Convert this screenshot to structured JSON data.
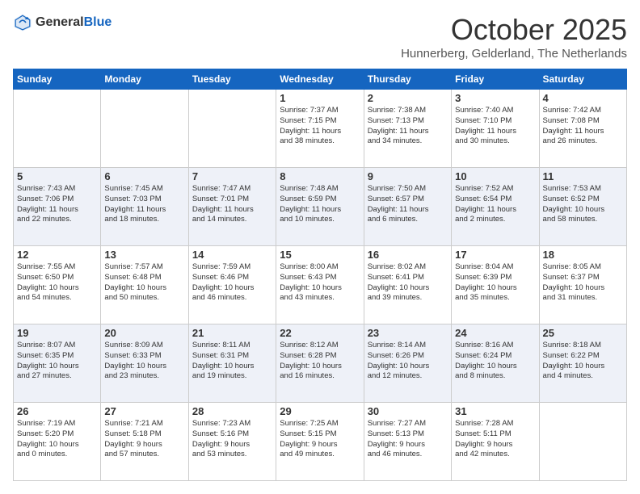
{
  "header": {
    "logo_general": "General",
    "logo_blue": "Blue",
    "month_title": "October 2025",
    "location": "Hunnerberg, Gelderland, The Netherlands"
  },
  "days_of_week": [
    "Sunday",
    "Monday",
    "Tuesday",
    "Wednesday",
    "Thursday",
    "Friday",
    "Saturday"
  ],
  "weeks": [
    [
      {
        "day": "",
        "info": ""
      },
      {
        "day": "",
        "info": ""
      },
      {
        "day": "",
        "info": ""
      },
      {
        "day": "1",
        "info": "Sunrise: 7:37 AM\nSunset: 7:15 PM\nDaylight: 11 hours\nand 38 minutes."
      },
      {
        "day": "2",
        "info": "Sunrise: 7:38 AM\nSunset: 7:13 PM\nDaylight: 11 hours\nand 34 minutes."
      },
      {
        "day": "3",
        "info": "Sunrise: 7:40 AM\nSunset: 7:10 PM\nDaylight: 11 hours\nand 30 minutes."
      },
      {
        "day": "4",
        "info": "Sunrise: 7:42 AM\nSunset: 7:08 PM\nDaylight: 11 hours\nand 26 minutes."
      }
    ],
    [
      {
        "day": "5",
        "info": "Sunrise: 7:43 AM\nSunset: 7:06 PM\nDaylight: 11 hours\nand 22 minutes."
      },
      {
        "day": "6",
        "info": "Sunrise: 7:45 AM\nSunset: 7:03 PM\nDaylight: 11 hours\nand 18 minutes."
      },
      {
        "day": "7",
        "info": "Sunrise: 7:47 AM\nSunset: 7:01 PM\nDaylight: 11 hours\nand 14 minutes."
      },
      {
        "day": "8",
        "info": "Sunrise: 7:48 AM\nSunset: 6:59 PM\nDaylight: 11 hours\nand 10 minutes."
      },
      {
        "day": "9",
        "info": "Sunrise: 7:50 AM\nSunset: 6:57 PM\nDaylight: 11 hours\nand 6 minutes."
      },
      {
        "day": "10",
        "info": "Sunrise: 7:52 AM\nSunset: 6:54 PM\nDaylight: 11 hours\nand 2 minutes."
      },
      {
        "day": "11",
        "info": "Sunrise: 7:53 AM\nSunset: 6:52 PM\nDaylight: 10 hours\nand 58 minutes."
      }
    ],
    [
      {
        "day": "12",
        "info": "Sunrise: 7:55 AM\nSunset: 6:50 PM\nDaylight: 10 hours\nand 54 minutes."
      },
      {
        "day": "13",
        "info": "Sunrise: 7:57 AM\nSunset: 6:48 PM\nDaylight: 10 hours\nand 50 minutes."
      },
      {
        "day": "14",
        "info": "Sunrise: 7:59 AM\nSunset: 6:46 PM\nDaylight: 10 hours\nand 46 minutes."
      },
      {
        "day": "15",
        "info": "Sunrise: 8:00 AM\nSunset: 6:43 PM\nDaylight: 10 hours\nand 43 minutes."
      },
      {
        "day": "16",
        "info": "Sunrise: 8:02 AM\nSunset: 6:41 PM\nDaylight: 10 hours\nand 39 minutes."
      },
      {
        "day": "17",
        "info": "Sunrise: 8:04 AM\nSunset: 6:39 PM\nDaylight: 10 hours\nand 35 minutes."
      },
      {
        "day": "18",
        "info": "Sunrise: 8:05 AM\nSunset: 6:37 PM\nDaylight: 10 hours\nand 31 minutes."
      }
    ],
    [
      {
        "day": "19",
        "info": "Sunrise: 8:07 AM\nSunset: 6:35 PM\nDaylight: 10 hours\nand 27 minutes."
      },
      {
        "day": "20",
        "info": "Sunrise: 8:09 AM\nSunset: 6:33 PM\nDaylight: 10 hours\nand 23 minutes."
      },
      {
        "day": "21",
        "info": "Sunrise: 8:11 AM\nSunset: 6:31 PM\nDaylight: 10 hours\nand 19 minutes."
      },
      {
        "day": "22",
        "info": "Sunrise: 8:12 AM\nSunset: 6:28 PM\nDaylight: 10 hours\nand 16 minutes."
      },
      {
        "day": "23",
        "info": "Sunrise: 8:14 AM\nSunset: 6:26 PM\nDaylight: 10 hours\nand 12 minutes."
      },
      {
        "day": "24",
        "info": "Sunrise: 8:16 AM\nSunset: 6:24 PM\nDaylight: 10 hours\nand 8 minutes."
      },
      {
        "day": "25",
        "info": "Sunrise: 8:18 AM\nSunset: 6:22 PM\nDaylight: 10 hours\nand 4 minutes."
      }
    ],
    [
      {
        "day": "26",
        "info": "Sunrise: 7:19 AM\nSunset: 5:20 PM\nDaylight: 10 hours\nand 0 minutes."
      },
      {
        "day": "27",
        "info": "Sunrise: 7:21 AM\nSunset: 5:18 PM\nDaylight: 9 hours\nand 57 minutes."
      },
      {
        "day": "28",
        "info": "Sunrise: 7:23 AM\nSunset: 5:16 PM\nDaylight: 9 hours\nand 53 minutes."
      },
      {
        "day": "29",
        "info": "Sunrise: 7:25 AM\nSunset: 5:15 PM\nDaylight: 9 hours\nand 49 minutes."
      },
      {
        "day": "30",
        "info": "Sunrise: 7:27 AM\nSunset: 5:13 PM\nDaylight: 9 hours\nand 46 minutes."
      },
      {
        "day": "31",
        "info": "Sunrise: 7:28 AM\nSunset: 5:11 PM\nDaylight: 9 hours\nand 42 minutes."
      },
      {
        "day": "",
        "info": ""
      }
    ]
  ]
}
